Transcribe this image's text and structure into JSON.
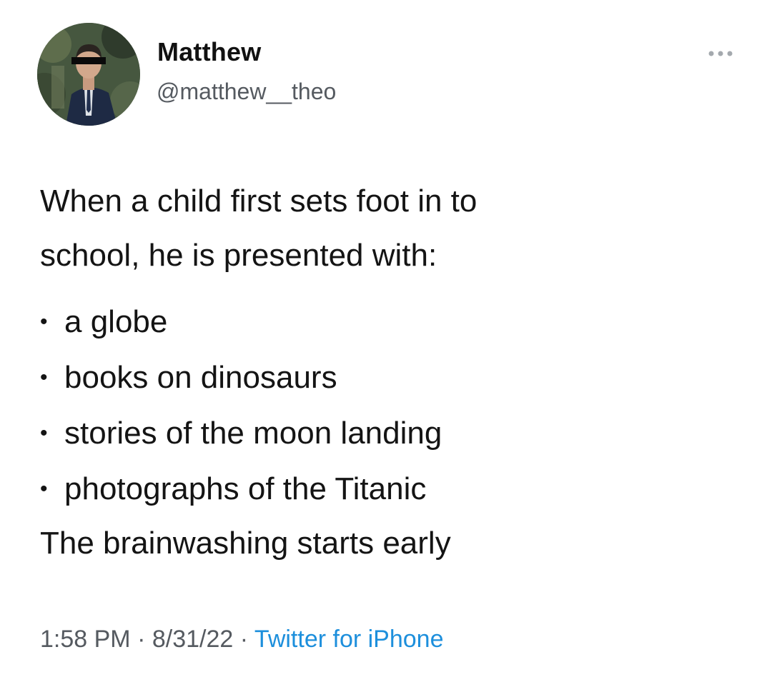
{
  "author": {
    "name": "Matthew",
    "handle": "@matthew__theo",
    "avatar_icon": "profile-photo"
  },
  "more_icon": "ellipsis-icon",
  "tweet": {
    "intro_lines": [
      "When a child first sets foot in to",
      "school, he is presented with:"
    ],
    "bullet_symbol": "•",
    "items": [
      "a globe",
      "books on dinosaurs",
      "stories of the moon landing",
      "photographs of the Titanic"
    ],
    "closing": "The brainwashing starts early"
  },
  "meta": {
    "time": "1:58 PM",
    "separator": "·",
    "date": "8/31/22",
    "source": "Twitter for iPhone"
  },
  "colors": {
    "link": "#1d8fdc",
    "secondary_text": "#555a60",
    "primary_text": "#141414"
  }
}
